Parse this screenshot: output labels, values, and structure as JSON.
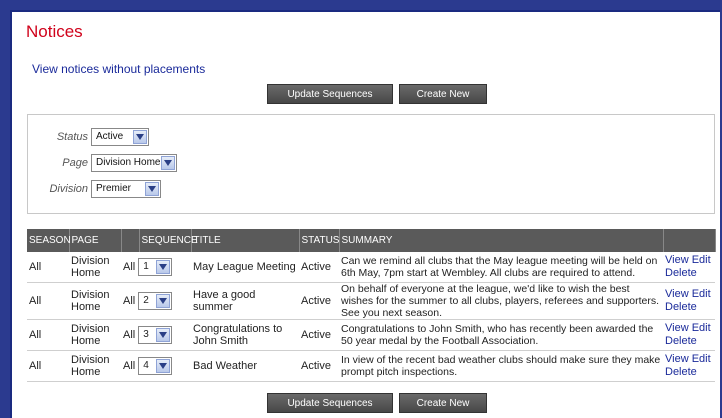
{
  "page": {
    "title": "Notices",
    "link_without_placements": "View notices without placements"
  },
  "buttons": {
    "update_sequences": "Update Sequences",
    "create_new": "Create New"
  },
  "filters": {
    "status": {
      "label": "Status",
      "value": "Active"
    },
    "page": {
      "label": "Page",
      "value": "Division Home"
    },
    "division": {
      "label": "Division",
      "value": "Premier"
    }
  },
  "table": {
    "headers": {
      "season": "SEASON",
      "page": "PAGE",
      "blank": "",
      "sequence": "SEQUENCE",
      "title": "TITLE",
      "status": "STATUS",
      "summary": "SUMMARY",
      "actions": ""
    },
    "rows": [
      {
        "season": "All",
        "page": "Division Home",
        "seq_all": "All",
        "seq": "1",
        "title": "May League Meeting",
        "status": "Active",
        "summary": "Can we remind all clubs that the May league meeting will be held on 6th May, 7pm start at Wembley. All clubs are required to attend.",
        "view": "View",
        "edit": "Edit",
        "delete": "Delete"
      },
      {
        "season": "All",
        "page": "Division Home",
        "seq_all": "All",
        "seq": "2",
        "title": "Have a good summer",
        "status": "Active",
        "summary": "On behalf of everyone at the league, we'd like to wish the best wishes for the summer to all clubs, players, referees and supporters. See you next season.",
        "view": "View",
        "edit": "Edit",
        "delete": "Delete"
      },
      {
        "season": "All",
        "page": "Division Home",
        "seq_all": "All",
        "seq": "3",
        "title": "Congratulations to John Smith",
        "status": "Active",
        "summary": "Congratulations to John Smith, who has recently been awarded the 50 year medal by the Football Association.",
        "view": "View",
        "edit": "Edit",
        "delete": "Delete"
      },
      {
        "season": "All",
        "page": "Division Home",
        "seq_all": "All",
        "seq": "4",
        "title": "Bad Weather",
        "status": "Active",
        "summary": "In view of the recent bad weather clubs should make sure they make prompt pitch inspections.",
        "view": "View",
        "edit": "Edit",
        "delete": "Delete"
      }
    ]
  }
}
